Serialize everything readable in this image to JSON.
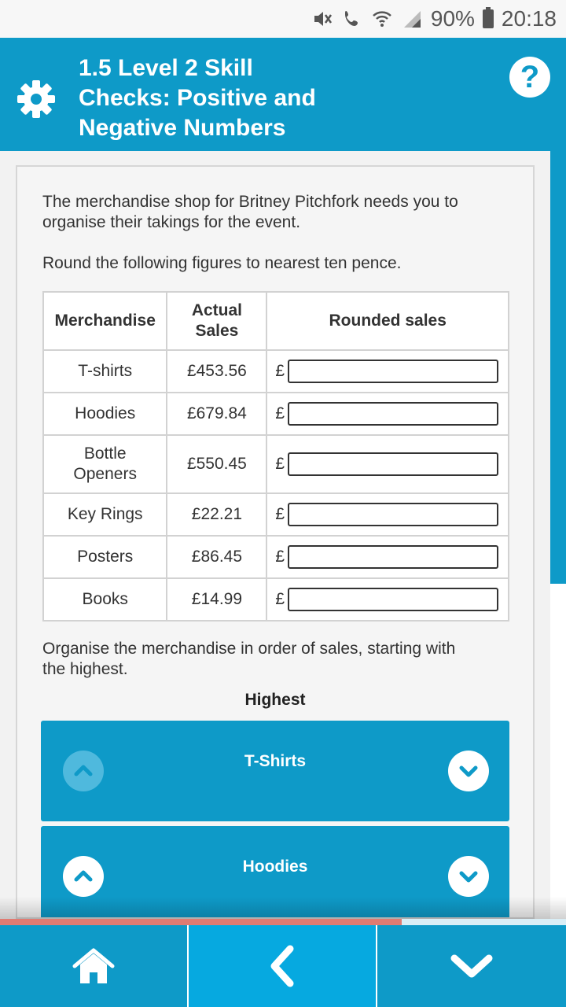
{
  "status_bar": {
    "battery": "90%",
    "time": "20:18",
    "icons": [
      "mute-icon",
      "call-icon",
      "wifi-icon",
      "signal-icon",
      "battery-icon"
    ]
  },
  "header": {
    "title_line1": "1.5 Level 2 Skill",
    "title_line2": "Checks: Positive and",
    "title_line3": "Negative Numbers",
    "help_label": "?"
  },
  "content": {
    "intro_line1": "The merchandise shop for Britney Pitchfork needs you to",
    "intro_line2": "organise their takings for the event.",
    "instruction": "Round the following figures to nearest ten pence.",
    "table": {
      "headers": [
        "Merchandise",
        "Actual Sales",
        "Rounded sales"
      ],
      "currency_symbol": "£",
      "rows": [
        {
          "item": "T-shirts",
          "sales": "£453.56",
          "rounded": ""
        },
        {
          "item": "Hoodies",
          "sales": "£679.84",
          "rounded": ""
        },
        {
          "item": "Bottle Openers",
          "sales": "£550.45",
          "rounded": ""
        },
        {
          "item": "Key Rings",
          "sales": "£22.21",
          "rounded": ""
        },
        {
          "item": "Posters",
          "sales": "£86.45",
          "rounded": ""
        },
        {
          "item": "Books",
          "sales": "£14.99",
          "rounded": ""
        }
      ]
    },
    "order_prompt_line1": "Organise the merchandise in order of sales, starting with",
    "order_prompt_line2": "the highest.",
    "highest_label": "Highest",
    "order_items": [
      {
        "label": "T-Shirts",
        "up_enabled": false
      },
      {
        "label": "Hoodies",
        "up_enabled": true
      }
    ]
  },
  "progress": {
    "fraction": 0.71
  },
  "colors": {
    "accent": "#0e9ac8",
    "active_nav": "#06a9e0",
    "progress": "#e07b72"
  }
}
